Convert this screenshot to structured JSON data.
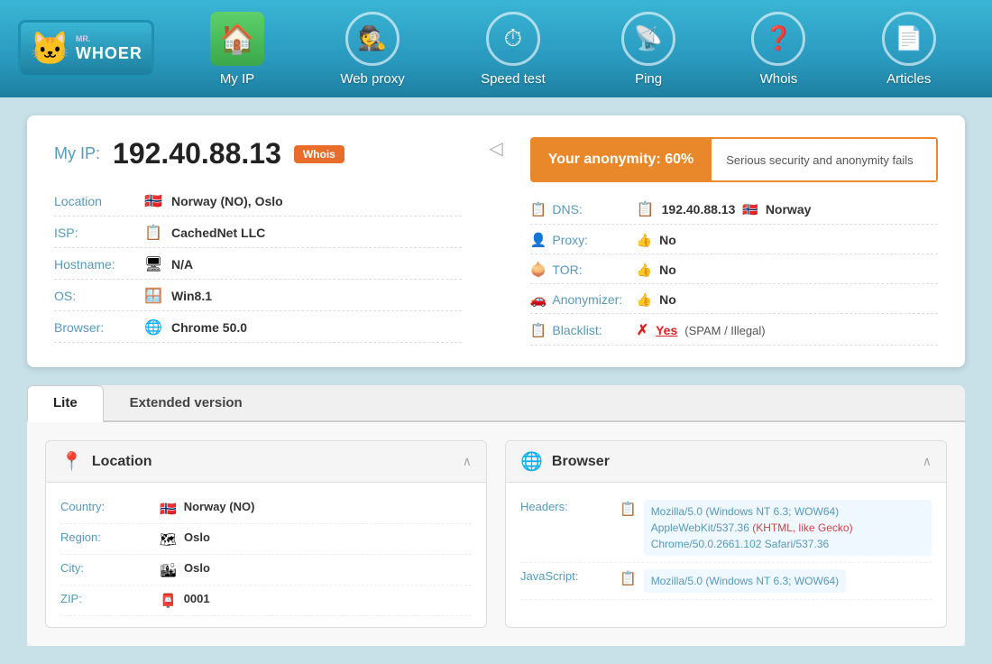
{
  "header": {
    "logo": {
      "mr": "mr.",
      "whoer": "WHOER",
      "animal": "🐱"
    },
    "nav": [
      {
        "id": "my-ip",
        "label": "My IP",
        "icon": "🏠",
        "iconType": "house"
      },
      {
        "id": "web-proxy",
        "label": "Web proxy",
        "icon": "🕵️",
        "iconType": "circle"
      },
      {
        "id": "speed-test",
        "label": "Speed test",
        "icon": "⏱",
        "iconType": "circle"
      },
      {
        "id": "ping",
        "label": "Ping",
        "icon": "📡",
        "iconType": "circle"
      },
      {
        "id": "whois",
        "label": "Whois",
        "icon": "❓",
        "iconType": "circle"
      },
      {
        "id": "articles",
        "label": "Articles",
        "icon": "📄",
        "iconType": "circle"
      }
    ]
  },
  "ip_card": {
    "my_ip_label": "My IP:",
    "ip_address": "192.40.88.13",
    "whois_badge": "Whois",
    "details": [
      {
        "label": "Location",
        "icon": "🇳🇴",
        "value": "Norway (NO), Oslo"
      },
      {
        "label": "ISP:",
        "icon": "📋",
        "value": "CachedNet LLC"
      },
      {
        "label": "Hostname:",
        "icon": "🖥",
        "value": "N/A"
      },
      {
        "label": "OS:",
        "icon": "🪟",
        "value": "Win8.1"
      },
      {
        "label": "Browser:",
        "icon": "🌐",
        "value": "Chrome 50.0"
      }
    ],
    "anonymity": {
      "percent_label": "Your anonymity: 60%",
      "status_label": "Serious security and anonymity fails"
    },
    "security": [
      {
        "label": "DNS:",
        "icon": "📋",
        "value": "192.40.88.13",
        "extra_flag": "🇳🇴",
        "extra_text": "Norway",
        "type": "text"
      },
      {
        "label": "Proxy:",
        "icon": "👤",
        "value": "No",
        "thumb": "👍",
        "type": "no"
      },
      {
        "label": "TOR:",
        "icon": "🧅",
        "value": "No",
        "thumb": "👍",
        "type": "no"
      },
      {
        "label": "Anonymizer:",
        "icon": "🚗",
        "value": "No",
        "thumb": "👍",
        "type": "no"
      },
      {
        "label": "Blacklist:",
        "icon": "📋",
        "value": "Yes",
        "spam": "(SPAM / Illegal)",
        "type": "yes"
      }
    ]
  },
  "tabs": {
    "active": "Lite",
    "items": [
      "Lite",
      "Extended version"
    ]
  },
  "panels": {
    "location": {
      "title": "Location",
      "icon": "📍",
      "rows": [
        {
          "label": "Country:",
          "icon": "🇳🇴",
          "value": "Norway (NO)"
        },
        {
          "label": "Region:",
          "icon": "🗺",
          "value": "Oslo"
        },
        {
          "label": "City:",
          "icon": "🏙",
          "value": "Oslo"
        },
        {
          "label": "ZIP:",
          "icon": "📮",
          "value": "0001"
        }
      ]
    },
    "browser": {
      "title": "Browser",
      "icon": "🌐",
      "rows": [
        {
          "label": "Headers:",
          "icon": "📋",
          "value": "Mozilla/5.0 (Windows NT 6.3; WOW64) AppleWebKit/537.36 (KHTML, like Gecko) Chrome/50.0.2661.102 Safari/537.36",
          "type": "header"
        },
        {
          "label": "JavaScript:",
          "icon": "📋",
          "value": "Mozilla/5.0 (Windows NT 6.3; WOW64)",
          "type": "header"
        }
      ]
    }
  }
}
